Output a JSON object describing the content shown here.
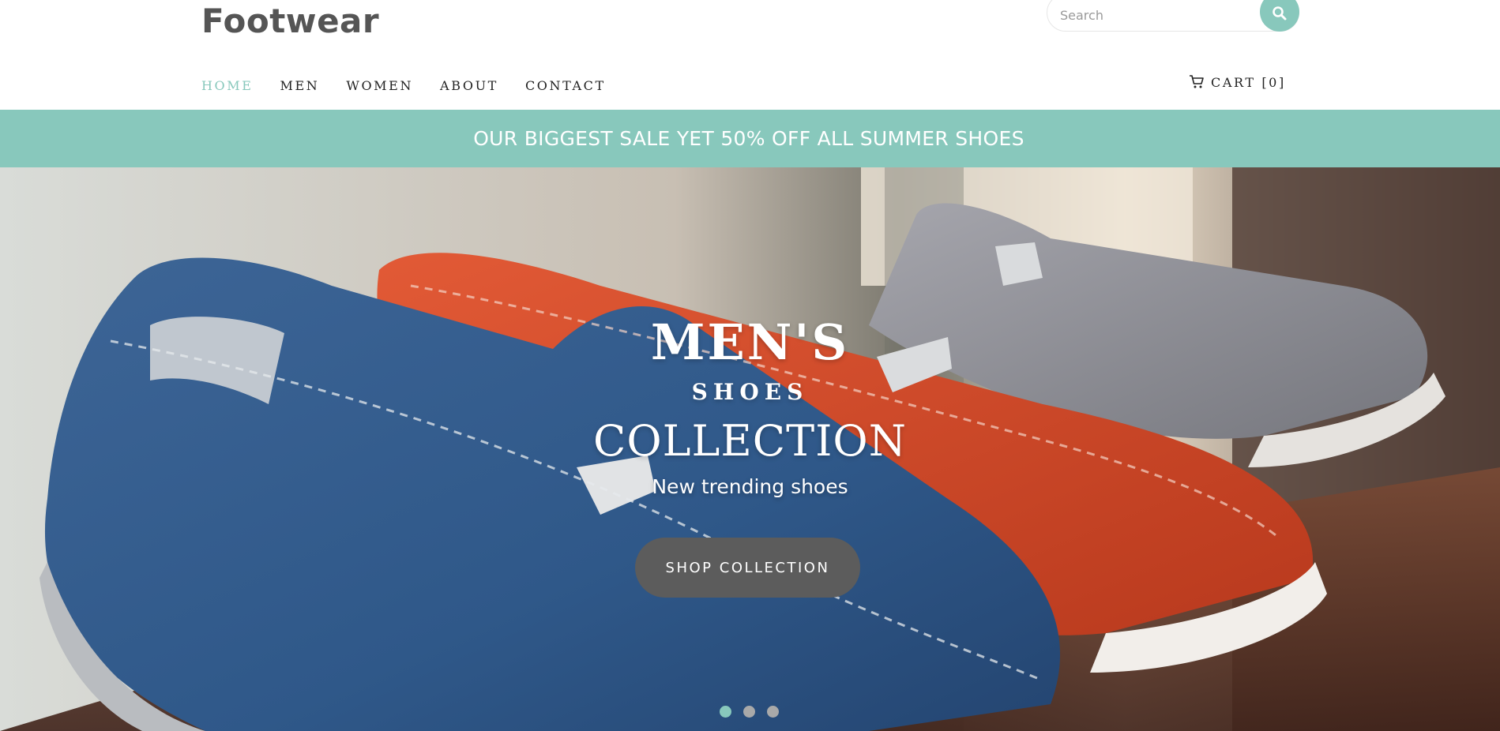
{
  "header": {
    "logo": "Footwear",
    "search_placeholder": "Search",
    "nav": [
      {
        "label": "HOME",
        "active": true
      },
      {
        "label": "MEN"
      },
      {
        "label": "WOMEN"
      },
      {
        "label": "ABOUT"
      },
      {
        "label": "CONTACT"
      }
    ],
    "cart_label": "CART [0]",
    "accent_color": "#88c8bc"
  },
  "banner": {
    "text": "OUR BIGGEST SALE YET 50% OFF ALL SUMMER SHOES"
  },
  "hero": {
    "title": "MEN'S",
    "subtitle": "SHOES",
    "collection": "COLLECTION",
    "tagline": "New trending shoes",
    "button_label": "SHOP COLLECTION",
    "slides": [
      {
        "active": true
      },
      {
        "active": false
      },
      {
        "active": false
      }
    ]
  },
  "icons": {
    "search": "search-icon",
    "cart": "cart-icon"
  }
}
